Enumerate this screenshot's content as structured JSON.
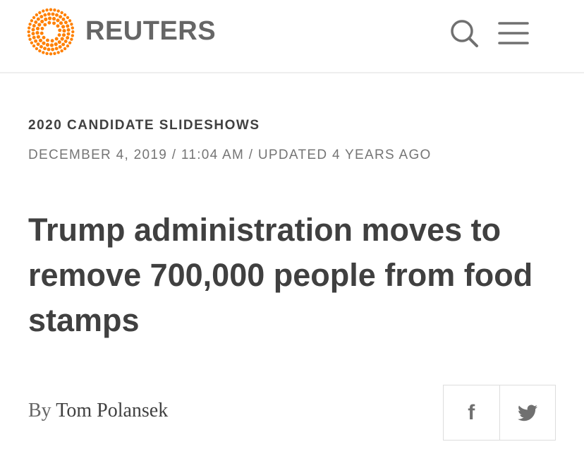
{
  "header": {
    "brand": "REUTERS",
    "logo_icon": "reuters-dot-circle-logo",
    "search_icon": "search-icon",
    "menu_icon": "hamburger-menu-icon",
    "brand_color": "#ff8000"
  },
  "article": {
    "section": "2020 CANDIDATE SLIDESHOWS",
    "date": "DECEMBER 4, 2019 / 11:04 AM / UPDATED 4 YEARS AGO",
    "headline": "Trump administration moves to remove 700,000 people from food stamps",
    "byline_prefix": "By",
    "author": "Tom Polansek"
  },
  "share": {
    "facebook_label": "f",
    "facebook_icon": "facebook-icon",
    "twitter_icon": "twitter-icon"
  }
}
